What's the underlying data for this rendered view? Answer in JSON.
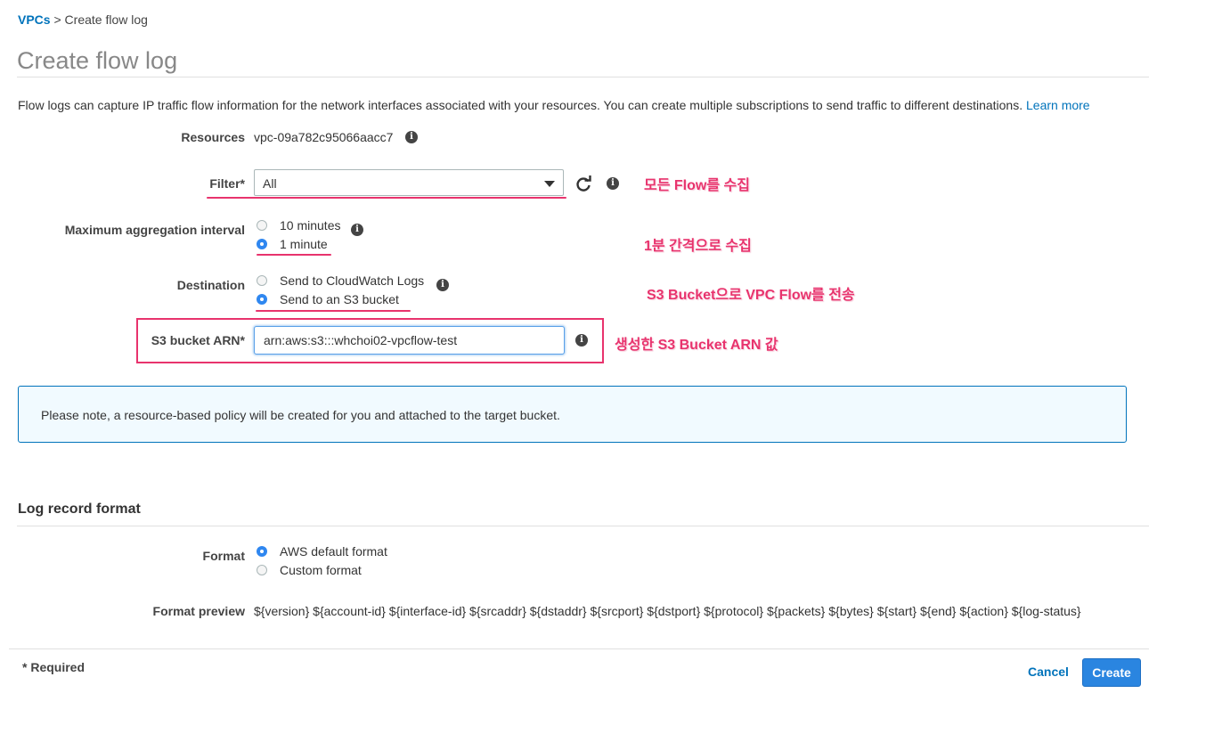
{
  "breadcrumb": {
    "parent": "VPCs",
    "separator": " > ",
    "current": "Create flow log"
  },
  "page_title": "Create flow log",
  "intro": {
    "text": "Flow logs can capture IP traffic flow information for the network interfaces associated with your resources. You can create multiple subscriptions to send traffic to different destinations.",
    "learn_more": "Learn more"
  },
  "resources": {
    "label": "Resources",
    "value": "vpc-09a782c95066aacc7"
  },
  "filter": {
    "label": "Filter*",
    "selected": "All"
  },
  "aggregation": {
    "label": "Maximum aggregation interval",
    "options": [
      {
        "label": "10 minutes",
        "checked": false
      },
      {
        "label": "1 minute",
        "checked": true
      }
    ]
  },
  "destination": {
    "label": "Destination",
    "options": [
      {
        "label": "Send to CloudWatch Logs",
        "checked": false
      },
      {
        "label": "Send to an S3 bucket",
        "checked": true
      }
    ]
  },
  "s3_arn": {
    "label": "S3 bucket ARN*",
    "value": "arn:aws:s3:::whchoi02-vpcflow-test"
  },
  "note": "Please note, a resource-based policy will be created for you and attached to the target bucket.",
  "log_format": {
    "section_title": "Log record format",
    "format_label": "Format",
    "options": [
      {
        "label": "AWS default format",
        "checked": true
      },
      {
        "label": "Custom format",
        "checked": false
      }
    ],
    "preview_label": "Format preview",
    "preview_value": "${version} ${account-id} ${interface-id} ${srcaddr} ${dstaddr} ${srcport} ${dstport} ${protocol} ${packets} ${bytes} ${start} ${end} ${action} ${log-status}"
  },
  "footer": {
    "required": "* Required",
    "cancel": "Cancel",
    "create": "Create"
  },
  "annotations": {
    "filter": "모든 Flow를 수집",
    "interval": "1분 간격으로 수집",
    "destination": "S3 Bucket으로 VPC Flow를 전송",
    "arn": "생성한 S3 Bucket ARN 값"
  },
  "colors": {
    "accent": "#0073bb",
    "annotation": "#e8336d",
    "primary_button": "#2a85e0"
  },
  "icons": {
    "info": "info-icon",
    "refresh": "refresh-icon",
    "dropdown": "chevron-down-icon"
  }
}
